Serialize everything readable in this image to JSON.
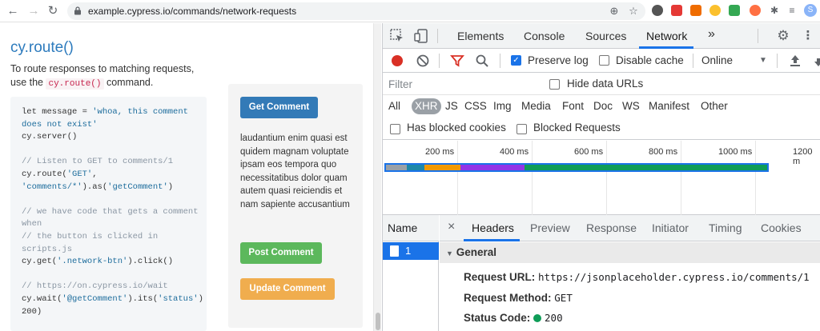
{
  "browser": {
    "url": "example.cypress.io/commands/network-requests",
    "avatar_letter": "S"
  },
  "docs": {
    "title": "cy.route()",
    "desc_before": "To route responses to matching requests, use the ",
    "desc_code": "cy.route()",
    "desc_after": " command.",
    "code": {
      "l1": "let message = ",
      "l1s": "'whoa, this comment",
      "l2s": "does not exist'",
      "l3": "cy.server()",
      "l4": "",
      "l5": "// Listen to GET to comments/1",
      "l6a": "cy.route(",
      "l6s": "'GET'",
      "l6b": ",",
      "l7s": "'comments/*'",
      "l7a": ").as(",
      "l7s2": "'getComment'",
      "l7b": ")",
      "l8": "",
      "l9": "// we have code that gets a comment",
      "l10": "when",
      "l11": "// the button is clicked in",
      "l12": "scripts.js",
      "l13a": "cy.get(",
      "l13s": "'.network-btn'",
      "l13b": ").click()",
      "l14": "",
      "l15": "// https://on.cypress.io/wait",
      "l16a": "cy.wait(",
      "l16s": "'@getComment'",
      "l16b": ").its(",
      "l16s2": "'status'",
      "l16c": ")",
      "l17": "200)"
    },
    "demo": {
      "get_button": "Get Comment",
      "comment_text": "laudantium enim quasi est quidem magnam voluptate ipsam eos tempora quo necessitatibus dolor quam autem quasi reiciendis et nam sapiente accusantium",
      "post_button": "Post Comment",
      "update_button": "Update Comment"
    }
  },
  "devtools": {
    "tabs": [
      "Elements",
      "Console",
      "Sources",
      "Network"
    ],
    "more": "»",
    "active_tab": "Network",
    "toolbar": {
      "preserve_log": "Preserve log",
      "disable_cache": "Disable cache",
      "throttle": "Online"
    },
    "filter_placeholder": "Filter",
    "hide_data_urls": "Hide data URLs",
    "types": [
      "All",
      "XHR",
      "JS",
      "CSS",
      "Img",
      "Media",
      "Font",
      "Doc",
      "WS",
      "Manifest",
      "Other"
    ],
    "active_type": "XHR",
    "has_blocked_cookies": "Has blocked cookies",
    "blocked_requests": "Blocked Requests",
    "timeline_ticks": [
      "200 ms",
      "400 ms",
      "600 ms",
      "800 ms",
      "1000 ms",
      "1200 m"
    ],
    "name_header": "Name",
    "request_name": "1",
    "detail_tabs": [
      "Headers",
      "Preview",
      "Response",
      "Initiator",
      "Timing",
      "Cookies"
    ],
    "close_glyph": "×",
    "general_header": "General",
    "request_url_label": "Request URL:",
    "request_url": "https://jsonplaceholder.cypress.io/comments/1",
    "request_method_label": "Request Method:",
    "request_method": "GET",
    "status_code_label": "Status Code:",
    "status_code": "200",
    "colors": {
      "accent": "#1a73e8",
      "record": "#d93025",
      "status_ok": "#0f9d58"
    }
  }
}
